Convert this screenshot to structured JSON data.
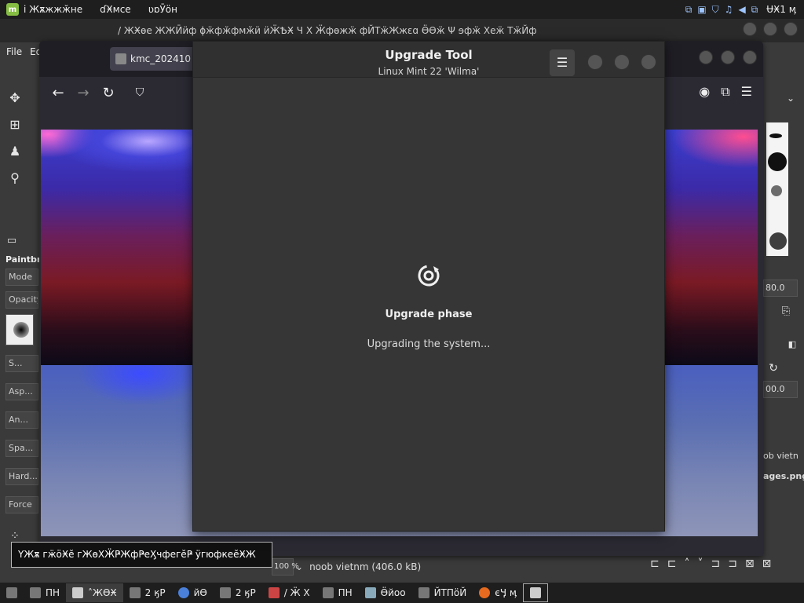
{
  "top_panel": {
    "title1": "і Жѫжжӂне",
    "title2": "ɗӾмсе",
    "title3": "ʋɒӮӧн",
    "clock": "ɄӾ1 ӎ",
    "tray_icons": [
      "network-icon",
      "notes-icon",
      "shield-icon",
      "audio-icon",
      "volume-icon",
      "display-icon"
    ]
  },
  "gimp": {
    "title": "/ ЖӾѳе  ЖЖӢӥф     ɸӝфӂфмӂӥ   ӥӜѢӾ Ч Х Ӝфѳжӝ фЙТӝЖжɛɑ   ӪѲӝ     Ψ       ɘфӝ Хеӝ ТӝЙф",
    "menu_file": "File",
    "menu_edit": "Ed",
    "options_label": "Paintbru",
    "mode": "Mode",
    "opacity": "Opacity",
    "opt_size": "S...",
    "opt_aspect": "Asp...",
    "opt_angle": "An...",
    "opt_spacing": "Spa...",
    "opt_hardness": "Hard...",
    "opt_force": "Force",
    "right_value1": "80.0",
    "right_value2": "00.0",
    "right_text1": "ob vietn",
    "right_text2": "ages.png",
    "zoom": "100 %",
    "status_text": "noob vietnm (406.0 kB)"
  },
  "browser": {
    "tab_title": "kmc_202410"
  },
  "upgrade_tool": {
    "title": "Upgrade Tool",
    "subtitle": "Linux Mint 22 'Wilma'",
    "menu_icon": "☰",
    "phase": "Upgrade phase",
    "status": "Upgrading the system..."
  },
  "tooltip": {
    "text": "ҮЖѫ гӝӧӾӗ гЖѳХӜҎЖфҎеӼчфегӗҎ ӱгюфкеӗӾЖ"
  },
  "taskbar": {
    "items": [
      {
        "label": "ПН"
      },
      {
        "label": "˄ЖѲӾ"
      },
      {
        "label": "2 ӄР"
      },
      {
        "label": "йӨ"
      },
      {
        "label": "2 ӄР"
      },
      {
        "label": "/ Ӝ Х"
      },
      {
        "label": "ПН"
      },
      {
        "label": "Ӫйоо"
      },
      {
        "label": "ЙТПӧЙ"
      },
      {
        "label": "єӋ ӎ"
      }
    ]
  }
}
